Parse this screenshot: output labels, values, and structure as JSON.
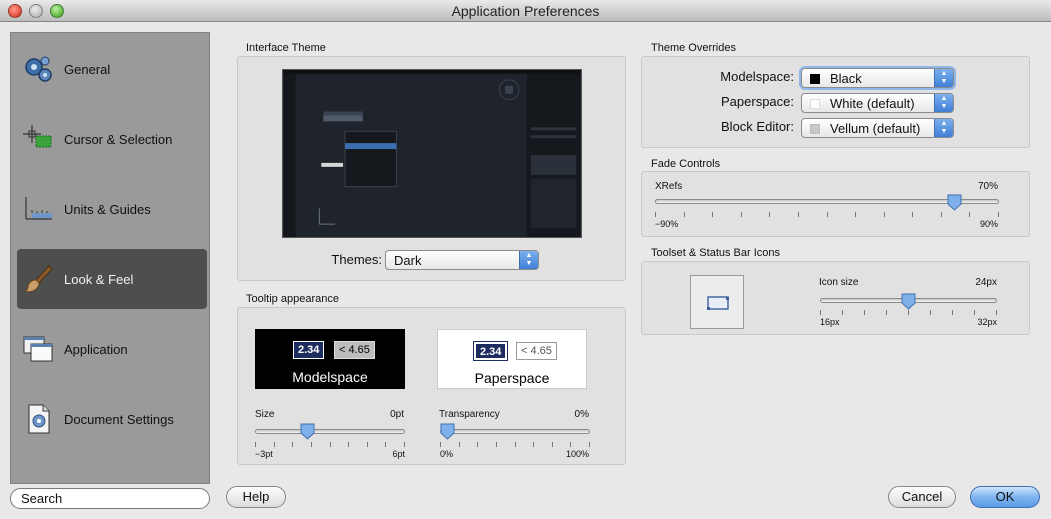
{
  "window": {
    "title": "Application Preferences"
  },
  "sidebar": {
    "items": [
      {
        "label": "General",
        "icon": "gears-icon"
      },
      {
        "label": "Cursor & Selection",
        "icon": "cursor-crosshair-icon"
      },
      {
        "label": "Units & Guides",
        "icon": "axes-graph-icon"
      },
      {
        "label": "Look & Feel",
        "icon": "paintbrush-icon",
        "active": true
      },
      {
        "label": "Application",
        "icon": "windows-icon"
      },
      {
        "label": "Document Settings",
        "icon": "document-settings-icon"
      }
    ]
  },
  "search": {
    "value": "Search"
  },
  "footer": {
    "help_label": "Help",
    "cancel_label": "Cancel",
    "ok_label": "OK"
  },
  "interface_theme": {
    "title": "Interface Theme",
    "themes_label": "Themes:",
    "themes_value": "Dark"
  },
  "tooltip": {
    "title": "Tooltip appearance",
    "sample_value_selected": "2.34",
    "sample_value_other": "< 4.65",
    "modelspace_label": "Modelspace",
    "paperspace_label": "Paperspace",
    "size": {
      "label": "Size",
      "value": "0pt",
      "min": "−3pt",
      "max": "6pt",
      "fraction": 0.333
    },
    "transparency": {
      "label": "Transparency",
      "value": "0%",
      "min": "0%",
      "max": "100%",
      "fraction": 0.0
    }
  },
  "theme_overrides": {
    "title": "Theme Overrides",
    "rows": [
      {
        "label": "Modelspace:",
        "value": "Black",
        "swatch": "#000000"
      },
      {
        "label": "Paperspace:",
        "value": "White (default)",
        "swatch": "#ffffff"
      },
      {
        "label": "Block Editor:",
        "value": "Vellum (default)",
        "swatch": "#c8c8c8"
      }
    ]
  },
  "fade_controls": {
    "title": "Fade Controls",
    "xrefs": {
      "label": "XRefs",
      "value": "70%",
      "min": "−90%",
      "max": "90%",
      "fraction": 0.889
    }
  },
  "toolset_icons": {
    "title": "Toolset & Status Bar Icons",
    "icon_size": {
      "label": "Icon size",
      "value": "24px",
      "min": "16px",
      "max": "32px",
      "fraction": 0.5
    }
  },
  "colors": {
    "accent": "#5b9be6",
    "sidebar_bg": "#9a9a9a",
    "sidebar_active": "#4e4e4e",
    "tooltip_selected": "#1c2c5e"
  }
}
